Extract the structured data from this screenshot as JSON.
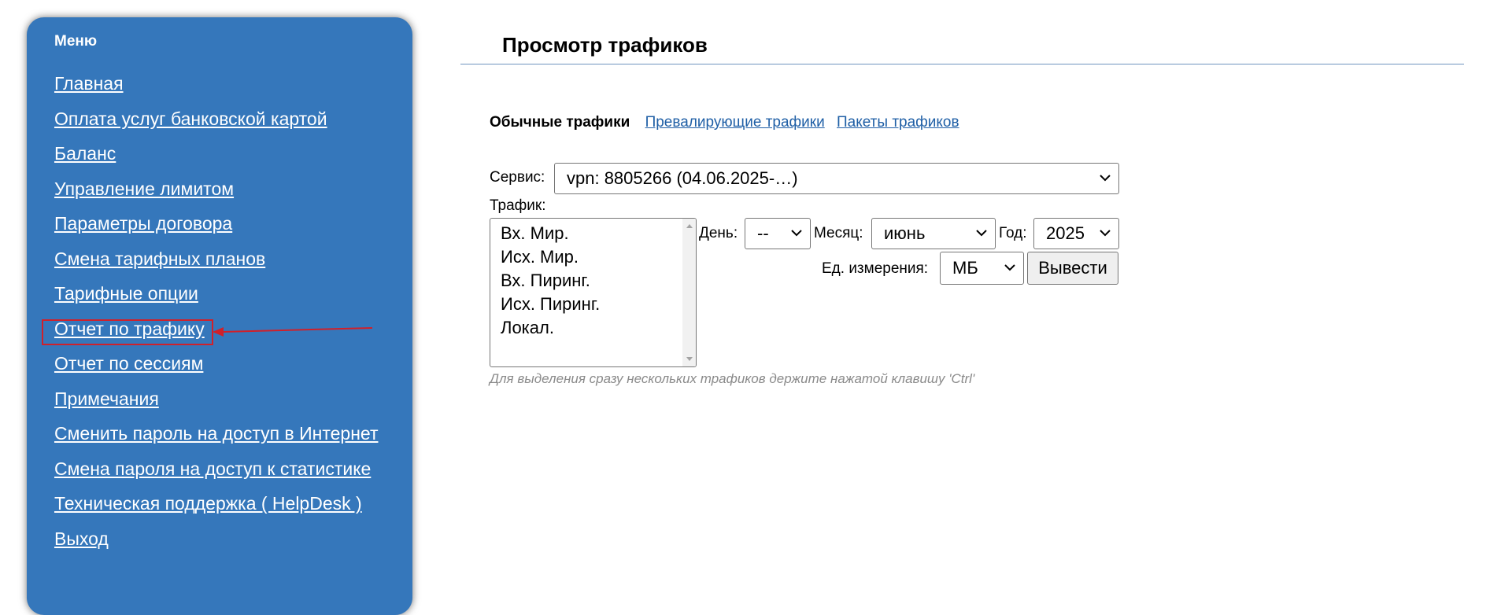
{
  "sidebar": {
    "title": "Меню",
    "items": [
      {
        "label": "Главная"
      },
      {
        "label": "Оплата услуг банковской картой"
      },
      {
        "label": "Баланс"
      },
      {
        "label": "Управление лимитом"
      },
      {
        "label": "Параметры договора"
      },
      {
        "label": "Смена тарифных планов"
      },
      {
        "label": "Тарифные опции"
      },
      {
        "label": "Отчет по трафику"
      },
      {
        "label": "Отчет по сессиям"
      },
      {
        "label": "Примечания"
      },
      {
        "label": "Сменить пароль на доступ в Интернет"
      },
      {
        "label": "Смена пароля на доступ к статистике"
      },
      {
        "label": "Техническая поддержка ( HelpDesk )"
      },
      {
        "label": "Выход"
      }
    ],
    "highlighted_item": "Отчет по трафику"
  },
  "page": {
    "title": "Просмотр трафиков"
  },
  "tabs": {
    "active": "Обычные трафики",
    "links": [
      "Превалирующие трафики",
      "Пакеты трафиков"
    ]
  },
  "form": {
    "service_label": "Сервис:",
    "service_value": "vpn: 8805266 (04.06.2025-…)",
    "traffic_label": "Трафик:",
    "traffic_options": [
      "Вх. Мир.",
      "Исх. Мир.",
      "Вх. Пиринг.",
      "Исх. Пиринг.",
      "Локал."
    ],
    "day_label": "День:",
    "day_value": "--",
    "month_label": "Месяц:",
    "month_value": "июнь",
    "year_label": "Год:",
    "year_value": "2025",
    "unit_label": "Ед. измерения:",
    "unit_value": "МБ",
    "submit_label": "Вывести",
    "hint": "Для выделения сразу нескольких трафиков держите нажатой клавишу 'Ctrl'"
  },
  "colors": {
    "sidebar_bg": "#3577bb",
    "link": "#1f5fa6",
    "annotation": "#d0202a"
  },
  "icons": {
    "select_arrow": "chevron-down-icon",
    "annotation_arrow": "arrow-left-icon"
  }
}
